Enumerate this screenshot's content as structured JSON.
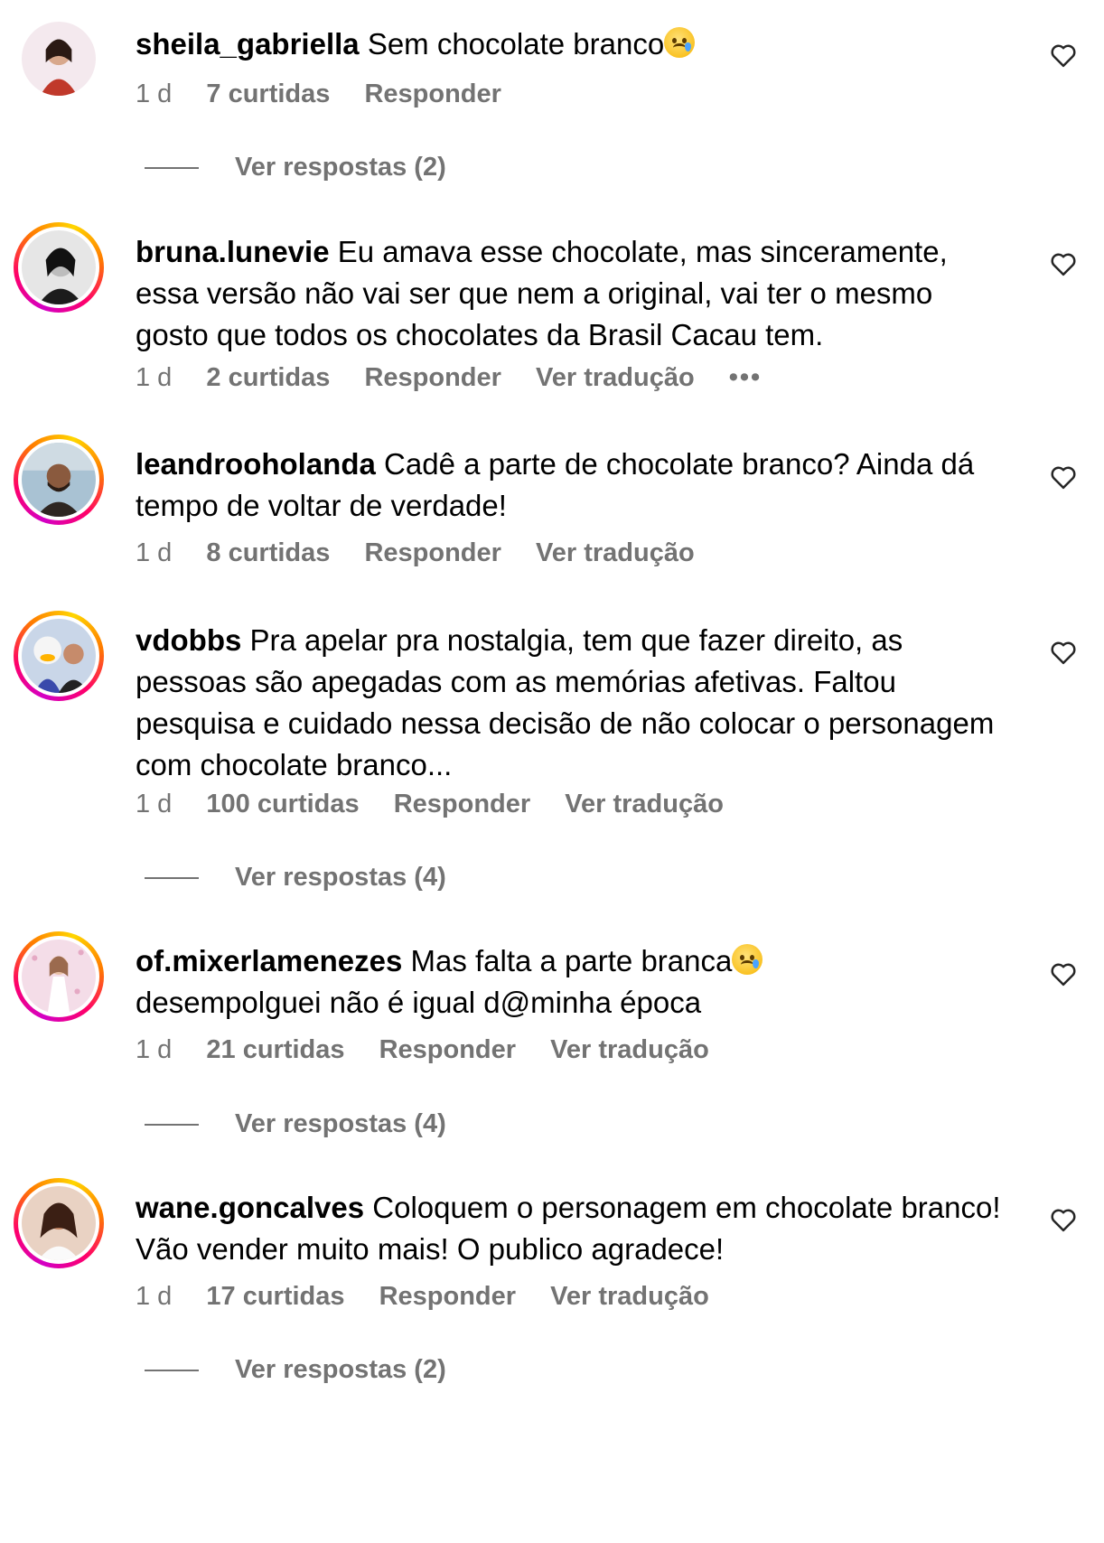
{
  "meta_labels": {
    "reply": "Responder",
    "translate": "Ver tradução",
    "more": "•••"
  },
  "comments": [
    {
      "username": "sheila_gabriella",
      "text": "Sem chocolate branco",
      "emoji": "crying-face",
      "age": "1 d",
      "likes": "7 curtidas",
      "replies": "Ver respostas (2)",
      "avatar_colors": [
        "#c0392b",
        "#7b1515"
      ]
    },
    {
      "username": "bruna.lunevie",
      "text": "Eu amava esse chocolate, mas sinceramente, essa versão não vai ser que nem a original, vai ter o mesmo gosto que todos os chocolates da Brasil Cacau tem.",
      "age": "1 d",
      "likes": "2 curtidas",
      "avatar_colors": [
        "#d9d9d9",
        "#2a2a2a"
      ]
    },
    {
      "username": "leandrooholanda",
      "text": "Cadê a parte de chocolate branco? Ainda dá tempo de voltar de verdade!",
      "age": "1 d",
      "likes": "8 curtidas",
      "avatar_colors": [
        "#9bb7c9",
        "#3d2b22"
      ]
    },
    {
      "username": "vdobbs",
      "text": "Pra apelar pra nostalgia, tem que fazer direito, as pessoas são apegadas com as memórias afetivas. Faltou pesquisa e cuidado nessa decisão de não colocar o personagem com chocolate branco...",
      "age": "1 d",
      "likes": "100 curtidas",
      "replies": "Ver respostas (4)",
      "avatar_colors": [
        "#5c6bc0",
        "#1a237e"
      ]
    },
    {
      "username": "of.mixerlamenezes",
      "text": "Mas falta a parte branca",
      "text2": "desempolguei não é igual d@minha época",
      "emoji": "crying-face",
      "age": "1 d",
      "likes": "21 curtidas",
      "replies": "Ver respostas (4)",
      "avatar_colors": [
        "#f3d7e4",
        "#c98aa8"
      ]
    },
    {
      "username": "wane.goncalves",
      "text": "Coloquem o personagem em chocolate branco! Vão vender muito mais! O publico agradece!",
      "age": "1 d",
      "likes": "17 curtidas",
      "replies": "Ver respostas (2)",
      "avatar_colors": [
        "#e6b9a0",
        "#5a2e1e"
      ]
    }
  ]
}
